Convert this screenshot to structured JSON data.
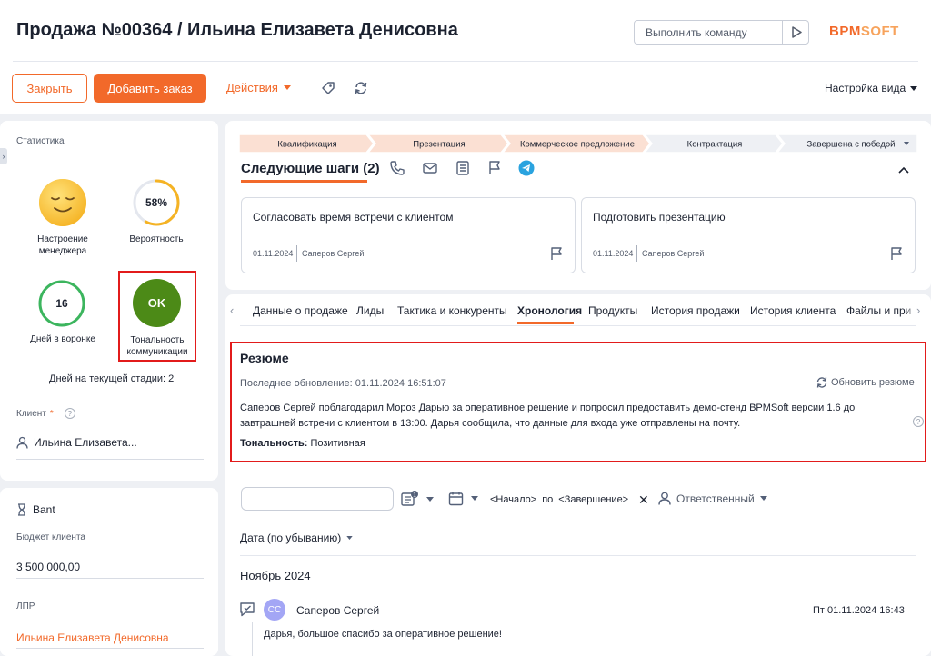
{
  "header": {
    "title": "Продажа №00364 / Ильина Елизавета Денисовна",
    "command_placeholder": "Выполнить команду",
    "logo": {
      "part1": "BPM",
      "part2": "SOFT"
    }
  },
  "toolbar": {
    "close_label": "Закрыть",
    "add_order_label": "Добавить заказ",
    "actions_label": "Действия",
    "view_settings_label": "Настройка вида"
  },
  "stats": {
    "label": "Статистика",
    "mood_caption": "Настроение менеджера",
    "probability": {
      "value": "58%",
      "fraction": 0.58,
      "caption": "Вероятность"
    },
    "days_in_funnel": {
      "value": "16",
      "caption": "Дней в воронке"
    },
    "tone": {
      "value": "OK",
      "caption": "Тональность коммуникации"
    },
    "stage_days": "Дней на текущей стадии: 2"
  },
  "client": {
    "label": "Клиент",
    "required_mark": "*",
    "help": "?",
    "value": "Ильина Елизавета..."
  },
  "bant": {
    "title": "Bant",
    "budget_label": "Бюджет клиента",
    "budget_value": "3 500 000,00",
    "lpr_label": "ЛПР",
    "lpr_value": "Ильина Елизавета Денисовна"
  },
  "stages": [
    {
      "label": "Квалификация",
      "done": true
    },
    {
      "label": "Презентация",
      "done": true
    },
    {
      "label": "Коммерческое предложение",
      "done": true
    },
    {
      "label": "Контрактация",
      "done": false
    },
    {
      "label": "Завершена с победой",
      "done": false
    }
  ],
  "next_steps": {
    "title": "Следующие шаги (2)",
    "tasks": [
      {
        "title": "Согласовать время встречи с клиентом",
        "date": "01.11.2024",
        "owner": "Саперов Сергей"
      },
      {
        "title": "Подготовить презентацию",
        "date": "01.11.2024",
        "owner": "Саперов Сергей"
      }
    ]
  },
  "tabs": [
    "Данные о продаже",
    "Лиды",
    "Тактика и конкуренты",
    "Хронология",
    "Продукты",
    "История продажи",
    "История клиента",
    "Файлы и при"
  ],
  "active_tab": "Хронология",
  "resume": {
    "title": "Резюме",
    "updated": "Последнее обновление: 01.11.2024 16:51:07",
    "refresh_label": "Обновить резюме",
    "text": "Саперов Сергей поблагодарил Мороз Дарью за оперативное решение и попросил предоставить демо-стенд BPMSoft версии 1.6 до завтрашней встречи с клиентом в 13:00. Дарья сообщила, что данные для входа уже отправлены на почту.",
    "tone_label": "Тональность:",
    "tone_value": "Позитивная",
    "help": "?"
  },
  "filters": {
    "badge": "1",
    "date_start": "<Начало>",
    "date_sep": "по",
    "date_end": "<Завершение>",
    "responsible_label": "Ответственный",
    "sort_label": "Дата (по убыванию)"
  },
  "timeline": {
    "month": "Ноябрь 2024",
    "entries": [
      {
        "initials": "СС",
        "author": "Саперов Сергей",
        "time": "Пт 01.11.2024 16:43",
        "text": "Дарья, большое спасибо за оперативное решение!"
      }
    ]
  },
  "colors": {
    "accent": "#f2692a",
    "tone_ok": "#4c8a17",
    "highlight": "#e21b1b",
    "gauge": "#f5b324",
    "days_ring": "#3cb55e"
  }
}
